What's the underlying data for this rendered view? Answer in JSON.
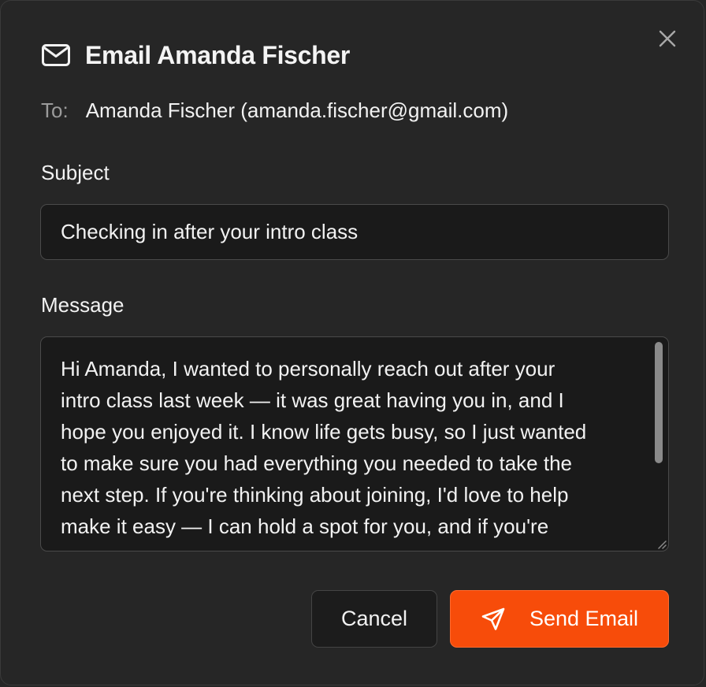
{
  "dialog": {
    "title": "Email Amanda Fischer",
    "title_icon": "mail-icon",
    "close_icon": "close-icon"
  },
  "recipient": {
    "label": "To:",
    "value": "Amanda Fischer (amanda.fischer@gmail.com)"
  },
  "subject": {
    "label": "Subject",
    "value": "Checking in after your intro class"
  },
  "message": {
    "label": "Message",
    "lines": [
      "Hi Amanda, I wanted to personally reach out after your",
      "intro class last week — it was great having you in, and I",
      "hope you enjoyed it. I know life gets busy, so I just wanted",
      "to make sure you had everything you needed to take the",
      "next step. If you're thinking about joining, I'd love to help",
      "make it easy — I can hold a spot for you, and if you're"
    ]
  },
  "actions": {
    "cancel_label": "Cancel",
    "send_label": "Send Email",
    "send_icon": "send-icon"
  },
  "colors": {
    "background": "#262626",
    "input_background": "#1a1a1a",
    "accent": "#f74c0a"
  }
}
